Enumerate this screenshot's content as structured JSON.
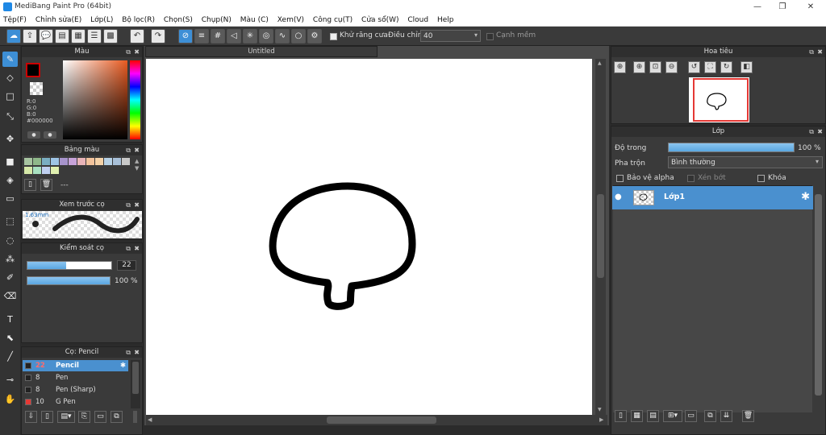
{
  "window": {
    "title": "MediBang Paint Pro (64bit)"
  },
  "menu": [
    "Tệp(F)",
    "Chỉnh sửa(E)",
    "Lớp(L)",
    "Bộ lọc(R)",
    "Chọn(S)",
    "Chụp(N)",
    "Màu (C)",
    "Xem(V)",
    "Công cụ(T)",
    "Cửa sổ(W)",
    "Cloud",
    "Help"
  ],
  "toolbar": {
    "antialias_label": "Khử răng cưa",
    "adjust_label": "Điều chỉnh",
    "adjust_value": "40",
    "edge_label": "Cạnh mềm"
  },
  "document": {
    "tab": "Untitled"
  },
  "color_panel": {
    "title": "Màu",
    "r": "R:0",
    "g": "G:0",
    "b": "B:0",
    "hex": "#000000"
  },
  "palette_panel": {
    "title": "Bảng màu",
    "dash": "---"
  },
  "preview_panel": {
    "title": "Xem trước cọ",
    "size": "1.63mm"
  },
  "brush_control": {
    "title": "Kiểm soát cọ",
    "size": "22",
    "opacity": "100 %",
    "size_fraction": 0.46,
    "opacity_fraction": 1.0
  },
  "brush_list": {
    "title": "Cọ: Pencil",
    "items": [
      {
        "size": "22",
        "name": "Pencil",
        "color": "#222222",
        "selected": true
      },
      {
        "size": "8",
        "name": "Pen",
        "color": "#222222",
        "selected": false
      },
      {
        "size": "8",
        "name": "Pen (Sharp)",
        "color": "#222222",
        "selected": false
      },
      {
        "size": "10",
        "name": "G Pen",
        "color": "#e53935",
        "selected": false
      }
    ]
  },
  "navigator": {
    "title": "Hoa tiêu"
  },
  "layer_panel": {
    "title": "Lớp",
    "opacity_label": "Độ trong",
    "opacity_value": "100 %",
    "opacity_fraction": 1.0,
    "blend_label": "Pha trộn",
    "blend_value": "Bình thường",
    "protect_alpha": "Bảo vệ alpha",
    "clipping": "Xén bớt",
    "lock": "Khóa",
    "layers": [
      {
        "name": "Lớp1"
      }
    ]
  },
  "colors": {
    "accent": "#3d8fd6",
    "layer_selected": "#4a90cf",
    "primary": "#000000"
  }
}
